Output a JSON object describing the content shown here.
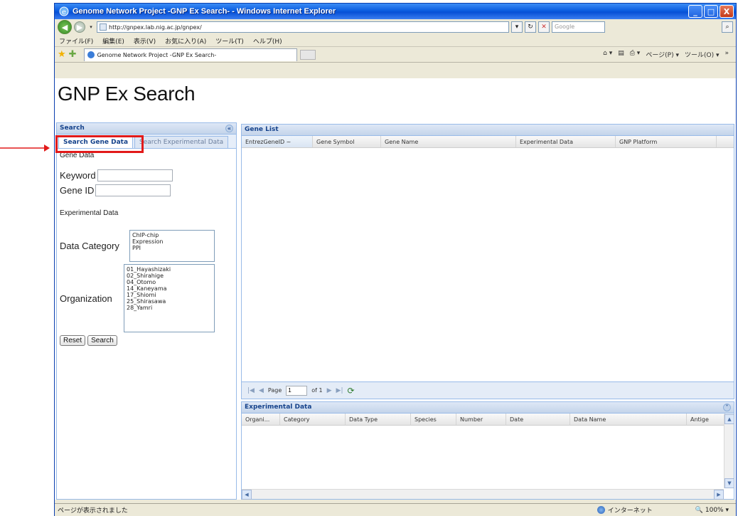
{
  "window": {
    "title": "Genome Network Project -GNP Ex Search- - Windows Internet Explorer",
    "controls": {
      "minimize": "_",
      "maximize": "□",
      "close": "X"
    }
  },
  "address": {
    "url": "http://gnpex.lab.nig.ac.jp/gnpex/",
    "search_placeholder": "Google"
  },
  "menu": [
    "ファイル(F)",
    "編集(E)",
    "表示(V)",
    "お気に入り(A)",
    "ツール(T)",
    "ヘルプ(H)"
  ],
  "browser_tab": {
    "label": "Genome Network Project -GNP Ex Search-"
  },
  "command_bar": [
    "ページ(P) ▾",
    "ツール(O) ▾"
  ],
  "app": {
    "title": "GNP Ex Search",
    "search_panel": {
      "title": "Search",
      "tabs": [
        "Search Gene Data",
        "Search Experimental Data"
      ],
      "gene_data_label": "Gene Data",
      "keyword_label": "Keyword",
      "gene_id_label": "Gene ID",
      "experimental_data_label": "Experimental Data",
      "data_category_label": "Data Category",
      "data_category_options": [
        "ChIP-chip",
        "Expression",
        "PPI"
      ],
      "organization_label": "Organization",
      "organization_options": [
        "01_Hayashizaki",
        "02_Shirahige",
        "04_Otomo",
        "14_Kaneyama",
        "17_Shiomi",
        "25_Shirasawa",
        "28_Yamri"
      ],
      "reset_label": "Reset",
      "search_label": "Search"
    },
    "gene_list": {
      "title": "Gene List",
      "columns": [
        "EntrezGeneID ~",
        "Gene Symbol",
        "Gene Name",
        "Experimental Data",
        "GNP Platform"
      ],
      "pager": {
        "page_label": "Page",
        "page_value": "1",
        "of_label": "of 1"
      }
    },
    "experimental_data": {
      "title": "Experimental Data",
      "columns": [
        "Organi...",
        "Category",
        "Data Type",
        "Species",
        "Number",
        "Date",
        "Data Name",
        "Antige"
      ]
    }
  },
  "status": {
    "text": "ページが表示されました",
    "zone": "インターネット",
    "zoom": "100%"
  },
  "colors": {
    "highlight": "#e21a1a",
    "panel_border": "#99bbe8",
    "panel_title": "#15428b"
  }
}
